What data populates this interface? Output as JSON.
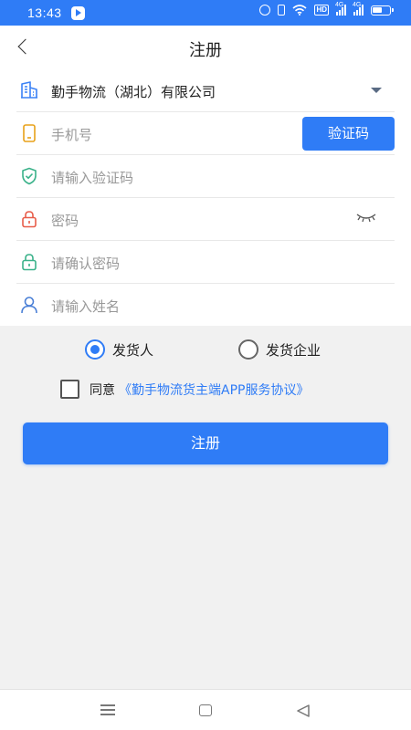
{
  "status_bar": {
    "time": "13:43",
    "hd_label": "HD",
    "signal_label_1": "4G",
    "signal_label_2": "4G"
  },
  "header": {
    "title": "注册"
  },
  "form": {
    "company": "勤手物流（湖北）有限公司",
    "phone_placeholder": "手机号",
    "code_button": "验证码",
    "code_placeholder": "请输入验证码",
    "password_placeholder": "密码",
    "confirm_password_placeholder": "请确认密码",
    "name_placeholder": "请输入姓名"
  },
  "role": {
    "options": [
      {
        "label": "发货人",
        "selected": true
      },
      {
        "label": "发货企业",
        "selected": false
      }
    ]
  },
  "agreement": {
    "agree_label": "同意",
    "link_text": "《勤手物流货主端APP服务协议》",
    "checked": false
  },
  "submit_label": "注册",
  "colors": {
    "accent": "#2f7cf6",
    "building_icon": "#3b82f6",
    "phone_icon": "#e8a21a",
    "shield_icon": "#3bb28a",
    "lock_icon": "#e85d4a",
    "lock_confirm_icon": "#3bb28a",
    "user_icon": "#4a7fd6"
  }
}
